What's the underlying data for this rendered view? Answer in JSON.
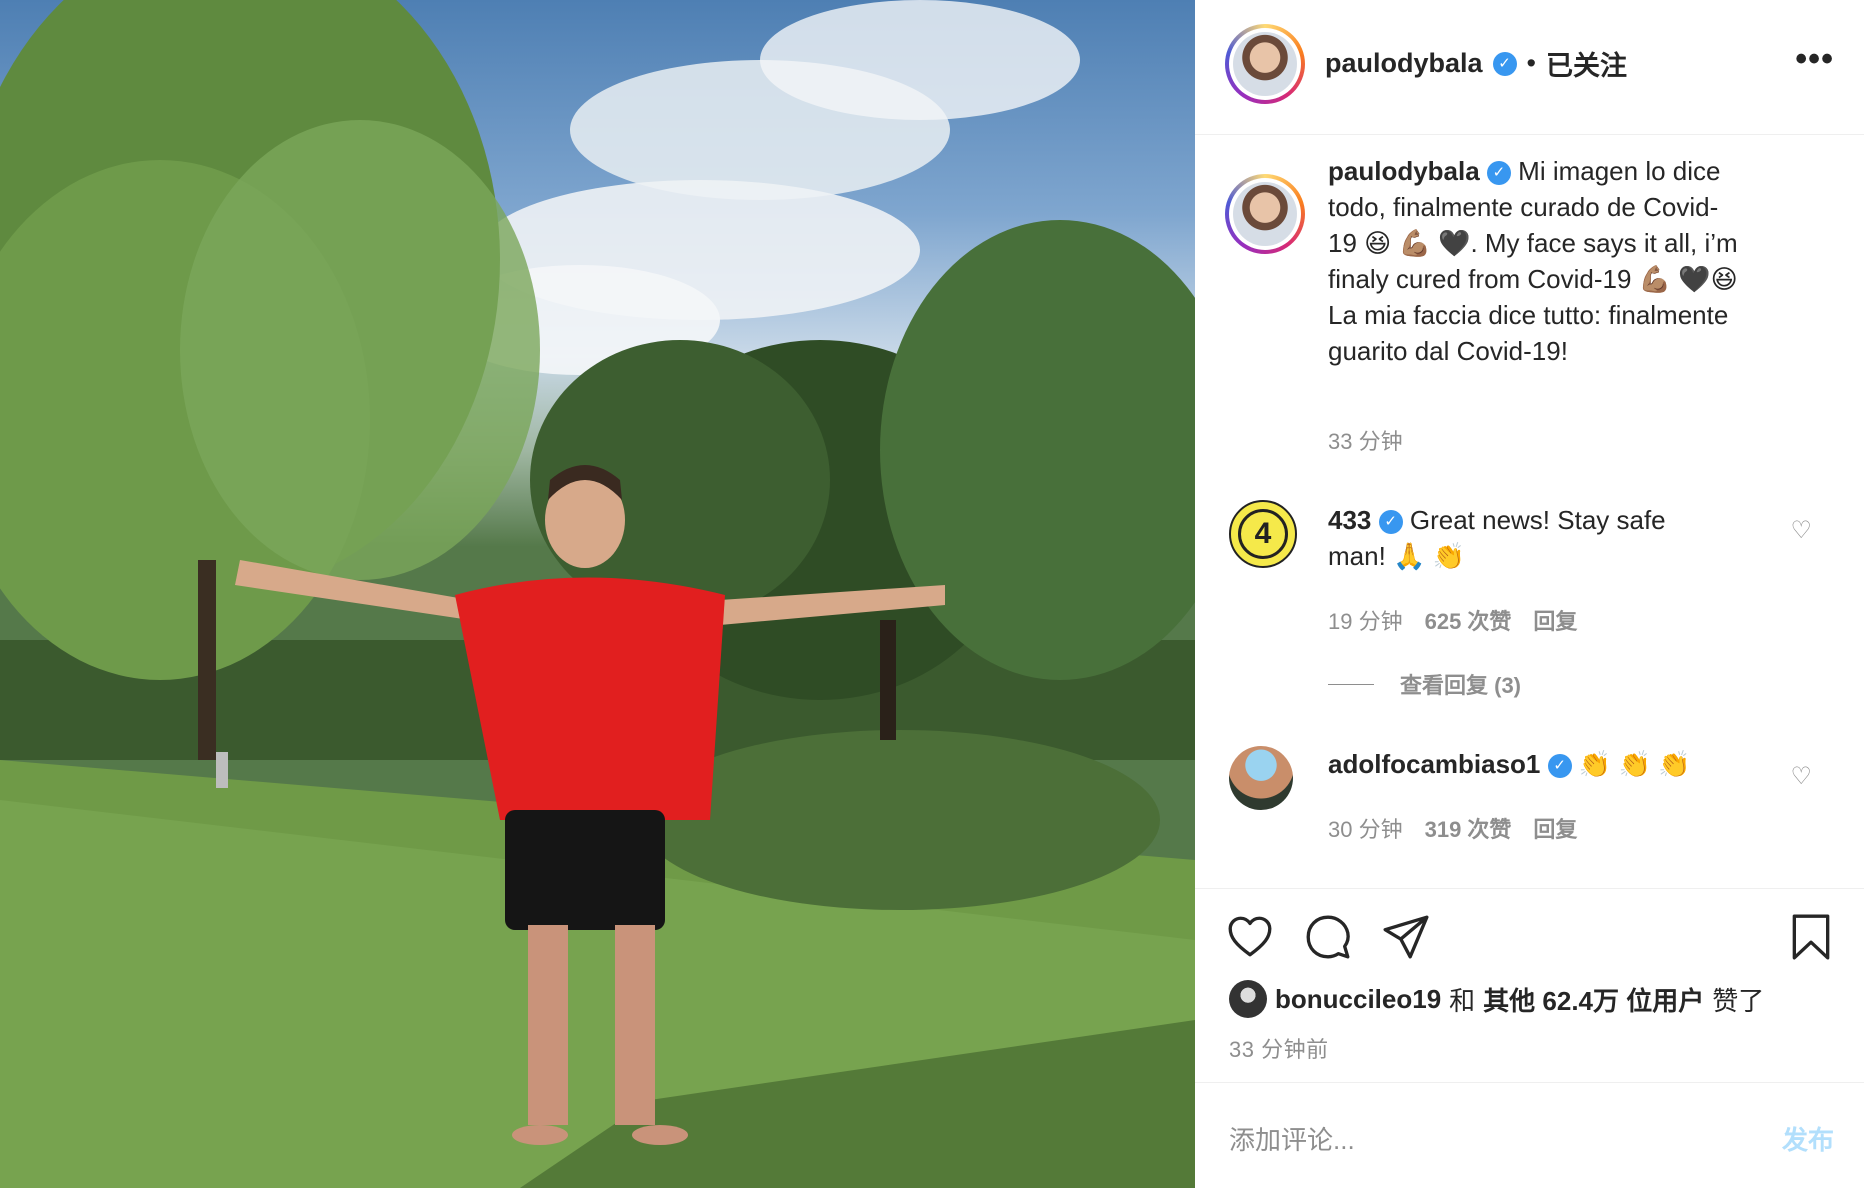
{
  "post": {
    "photo_alt": "photo-of-man-in-garden",
    "author": {
      "username": "paulodybala",
      "verified": true,
      "separator": "•",
      "follow_status": "已关注"
    },
    "more_icon": "more-horizontal-icon",
    "caption": {
      "username": "paulodybala",
      "text": "Mi imagen lo dice todo, finalmente curado de Covid-19 😆 💪🏽 🖤. My face says it all, i’m finaly cured from Covid-19 💪🏽 🖤😆 La mia faccia dice tutto: finalmente guarito dal Covid-19!",
      "time": "33 分钟"
    },
    "comments": [
      {
        "username": "433",
        "verified": true,
        "text": "Great news! Stay safe man! 🙏 👏",
        "time": "19 分钟",
        "likes": "625 次赞",
        "reply": "回复",
        "view_replies": "查看回复 (3)"
      },
      {
        "username": "adolfocambiaso1",
        "verified": true,
        "text": "👏 👏 👏",
        "time": "30 分钟",
        "likes": "319 次赞",
        "reply": "回复"
      }
    ],
    "likes_summary": {
      "liker": "bonuccileo19",
      "and": "和",
      "others": "其他 62.4万 位用户",
      "liked": "赞了"
    },
    "post_time": "33 分钟前",
    "add_comment_placeholder": "添加评论...",
    "post_button": "发布",
    "colors": {
      "link_blue": "#3897f0",
      "post_btn_disabled": "#b2dffc",
      "muted": "#8e8e8e"
    }
  }
}
